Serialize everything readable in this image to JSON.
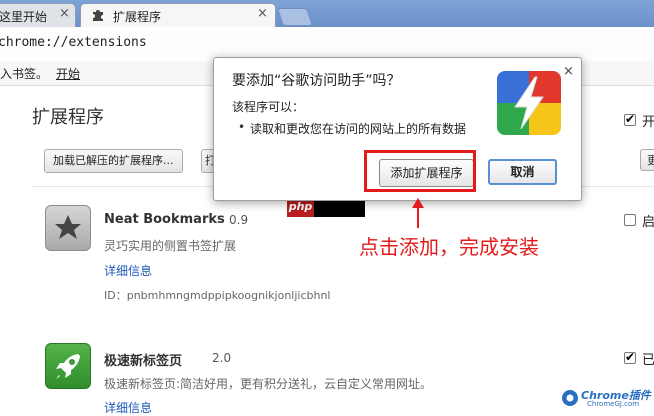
{
  "tabs": [
    {
      "title": "这里开始",
      "close": "×"
    },
    {
      "title": "扩展程序",
      "close": "×"
    }
  ],
  "toolbar": {
    "url": "chrome://extensions"
  },
  "bookmarks": {
    "text": "入书签。",
    "link": "开始"
  },
  "page": {
    "title": "扩展程序",
    "load_button": "加载已解压的扩展程序...",
    "pack_button": "打",
    "right_button": "更",
    "dev_mode_label": "开",
    "extensions": [
      {
        "name": "Neat Bookmarks",
        "version": "0.9",
        "description": "灵巧实用的侧置书签扩展",
        "details": "详细信息",
        "id": "ID：pnbmhmngmdppipkoognikjonljicbhnl",
        "enabled_label": "启",
        "enabled": false,
        "icon": "star-icon"
      },
      {
        "name": "极速新标签页",
        "version": "2.0",
        "description": "极速新标签页:简洁好用，更有积分送礼，云自定义常用网址。",
        "details": "详细信息",
        "enabled_label": "已",
        "enabled": true,
        "icon": "rocket-icon"
      }
    ]
  },
  "dialog": {
    "title": "要添加“谷歌访问助手”吗？",
    "subtitle": "该程序可以：",
    "permission_bullet": "•",
    "permission": "读取和更改您在访问的网站上的所有数据",
    "close": "×",
    "add_button": "添加扩展程序",
    "cancel_button": "取消",
    "logo": "lightning-logo-icon"
  },
  "annotation": {
    "text": "点击添加，完成安装",
    "color": "#e31b1b"
  },
  "badge": {
    "text": "php"
  },
  "watermark": {
    "text": "Chrome插件",
    "sub": "ChromeGJ.com"
  },
  "colors": {
    "link": "#1a57b8",
    "accent": "#e31b1b",
    "cancel_border": "#5a8fd8"
  }
}
